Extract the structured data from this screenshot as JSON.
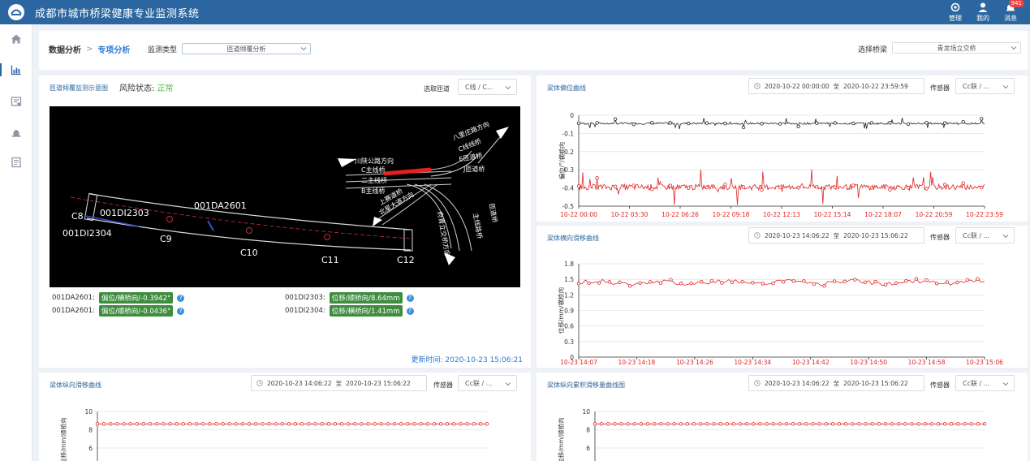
{
  "header": {
    "title": "成都市城市桥梁健康专业监测系统",
    "actions": [
      {
        "label": "管理",
        "icon": "gear-icon"
      },
      {
        "label": "我的",
        "icon": "user-icon"
      },
      {
        "label": "消息",
        "icon": "bell-icon",
        "badge": "941"
      }
    ]
  },
  "sidebar": {
    "items": [
      {
        "icon": "home-icon",
        "active": false
      },
      {
        "icon": "chart-icon",
        "active": true
      },
      {
        "icon": "report-icon",
        "active": false
      },
      {
        "icon": "alarm-icon",
        "active": false
      },
      {
        "icon": "document-icon",
        "active": false
      }
    ]
  },
  "filter": {
    "breadcrumb_root": "数据分析",
    "breadcrumb_current": "专项分析",
    "type_label": "监测类型",
    "type_value": "匝道倾覆分析",
    "bridge_label": "选择桥梁",
    "bridge_value": "青龙场立交桥"
  },
  "panel_main": {
    "title": "匝道倾覆监测示意图",
    "risk_label": "风险状态:",
    "risk_value": "正常",
    "ramp_label": "选取匝道",
    "ramp_value": "C线 / C...",
    "diagram_labels": {
      "c8": "C8",
      "c9": "C9",
      "c10": "C10",
      "c11": "C11",
      "c12": "C12",
      "di2303": "001DI2303",
      "di2304": "001DI2304",
      "da2601": "001DA2601",
      "dir_sichuan": "川陕公路方向",
      "line_c": "C主线桥",
      "line_2": "二主线桥",
      "line_b": "B主线桥",
      "dir_balizhuang": "八里庄路方向",
      "c_line_bridge": "C线线桥",
      "e_ramp": "E匝道桥",
      "j_ramp": "J匝道桥",
      "ramp_a": "匝道桥",
      "ramp_b": "主线路桥",
      "zone1": "上赛道桥",
      "zone2": "北星大道方向",
      "zone3": "府青立交桥方向"
    },
    "readings": [
      {
        "sensor": "001DA2601:",
        "value": "偏位/横桥向/-0.3942°"
      },
      {
        "sensor": "001DI2303:",
        "value": "位移/顺桥向/8.64mm"
      },
      {
        "sensor": "001DA2601:",
        "value": "偏位/顺桥向/-0.0436°"
      },
      {
        "sensor": "001DI2304:",
        "value": "位移/横桥向/1.41mm"
      }
    ],
    "updated_label": "更新时间:",
    "updated_value": "2020-10-23 15:06:21"
  },
  "panels": {
    "tilt": {
      "title": "梁体偏位曲线",
      "start": "2020-10-22 00:00:00",
      "to": "至",
      "end": "2020-10-22 23:59:59",
      "sensor_label": "传感器",
      "sensor_value": "Cc联 / ..."
    },
    "lateral": {
      "title": "梁体横向滑移曲线",
      "start": "2020-10-23 14:06:22",
      "to": "至",
      "end": "2020-10-23 15:06:22",
      "sensor_label": "传感器",
      "sensor_value": "Cc联 / ..."
    },
    "longitudinal": {
      "title": "梁体纵向滑移曲线",
      "start": "2020-10-23 14:06:22",
      "to": "至",
      "end": "2020-10-23 15:06:22",
      "sensor_label": "传感器",
      "sensor_value": "Cc联 / ..."
    },
    "cumulative": {
      "title": "梁体纵向累积滑移量曲线图",
      "start": "2020-10-23 14:06:22",
      "to": "至",
      "end": "2020-10-23 15:06:22",
      "sensor_label": "传感器",
      "sensor_value": "Cc联 / ..."
    }
  },
  "chart_data": [
    {
      "id": "tilt",
      "type": "line",
      "ylabel": "偏位/°/横桥向",
      "ylim": [
        -0.5,
        0
      ],
      "yticks": [
        "0",
        "-0.1",
        "-0.2",
        "-0.3",
        "-0.4",
        "-0.5"
      ],
      "x": [
        "10-22 00:00",
        "10-22 03:30",
        "10-22 06:26",
        "10-22 09:18",
        "10-22 12:13",
        "10-22 15:14",
        "10-22 18:07",
        "10-22 20:59",
        "10-22 23:59"
      ],
      "series": [
        {
          "color": "#222222",
          "baseline": -0.045,
          "noise": 0.03
        },
        {
          "color": "#e02424",
          "baseline": -0.395,
          "noise": 0.09
        }
      ]
    },
    {
      "id": "lateral",
      "type": "line",
      "ylabel": "位移/mm/横桥向",
      "ylim": [
        0,
        1.8
      ],
      "yticks": [
        "1.8",
        "1.5",
        "1.2",
        "0.9",
        "0.6",
        "0.3",
        "0"
      ],
      "x": [
        "10-23 14:07",
        "10-23 14:18",
        "10-23 14:26",
        "10-23 14:34",
        "10-23 14:42",
        "10-23 14:50",
        "10-23 14:58",
        "10-23 15:06"
      ],
      "series": [
        {
          "color": "#e02424",
          "baseline": 1.44,
          "noise": 0.08
        }
      ]
    },
    {
      "id": "longitudinal",
      "type": "line",
      "ylabel": "位移/mm/顺桥向",
      "ylim": [
        0,
        10
      ],
      "yticks": [
        "10",
        "8",
        "6"
      ],
      "series": [
        {
          "color": "#e02424",
          "baseline": 8.64,
          "noise": 0
        }
      ]
    },
    {
      "id": "cumulative",
      "type": "line",
      "ylabel": "位移/mm/顺桥向",
      "ylim": [
        0,
        10
      ],
      "yticks": [
        "10",
        "8",
        "6"
      ],
      "series": [
        {
          "color": "#e02424",
          "baseline": 8.64,
          "noise": 0
        }
      ]
    }
  ]
}
